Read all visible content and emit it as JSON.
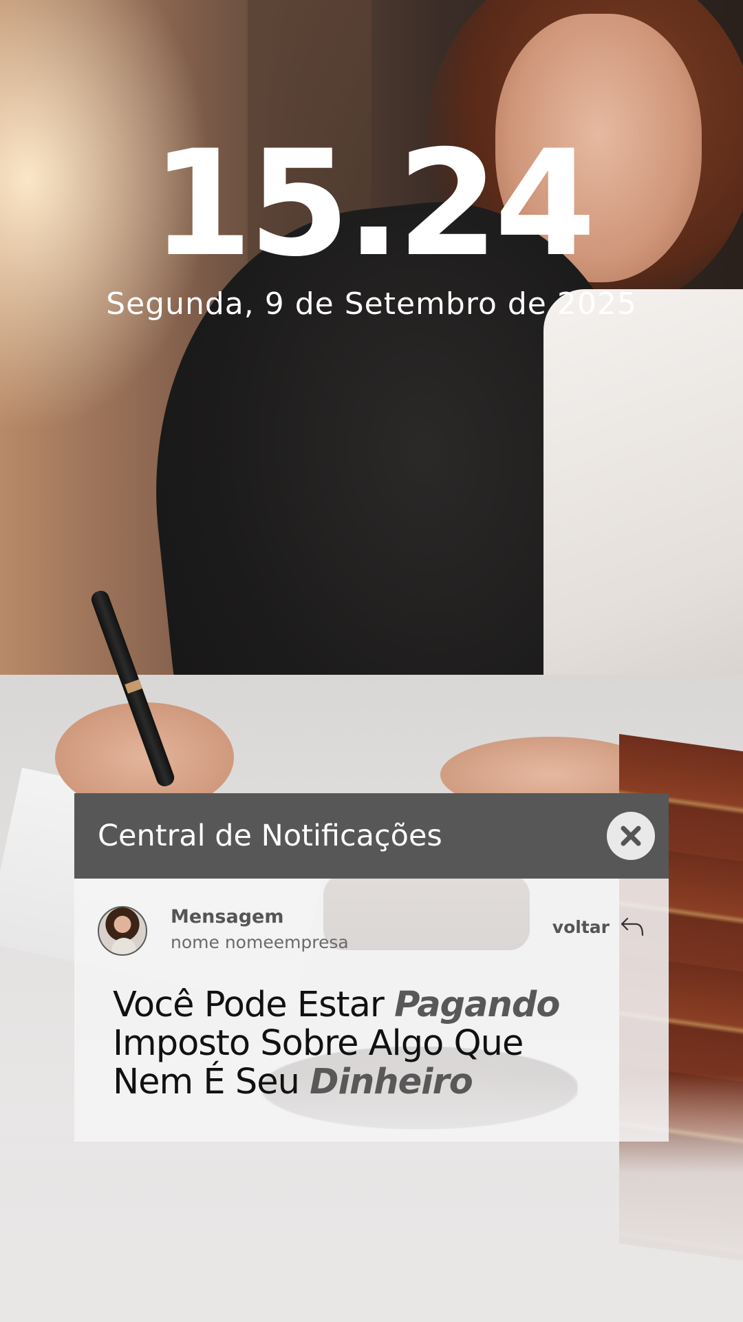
{
  "lockscreen": {
    "time": "15.24",
    "date": "Segunda, 9 de Setembro de 2025"
  },
  "notification_center": {
    "title": "Central de Notificações",
    "close_icon": "close-icon",
    "message": {
      "title": "Mensagem",
      "sender": "nome nomeempresa",
      "back_label": "voltar",
      "back_icon": "reply-arrow-icon",
      "headline": {
        "line1_plain": "Você Pode Estar ",
        "line1_emphasis": "Pagando",
        "line2": "Imposto Sobre Algo Que",
        "line3_plain": "Nem É Seu ",
        "line3_emphasis": "Dinheiro"
      }
    }
  },
  "colors": {
    "header_bg": "#575757",
    "body_bg": "#f5f5f6",
    "emphasis": "#585858",
    "clock_text": "#ffffff"
  }
}
